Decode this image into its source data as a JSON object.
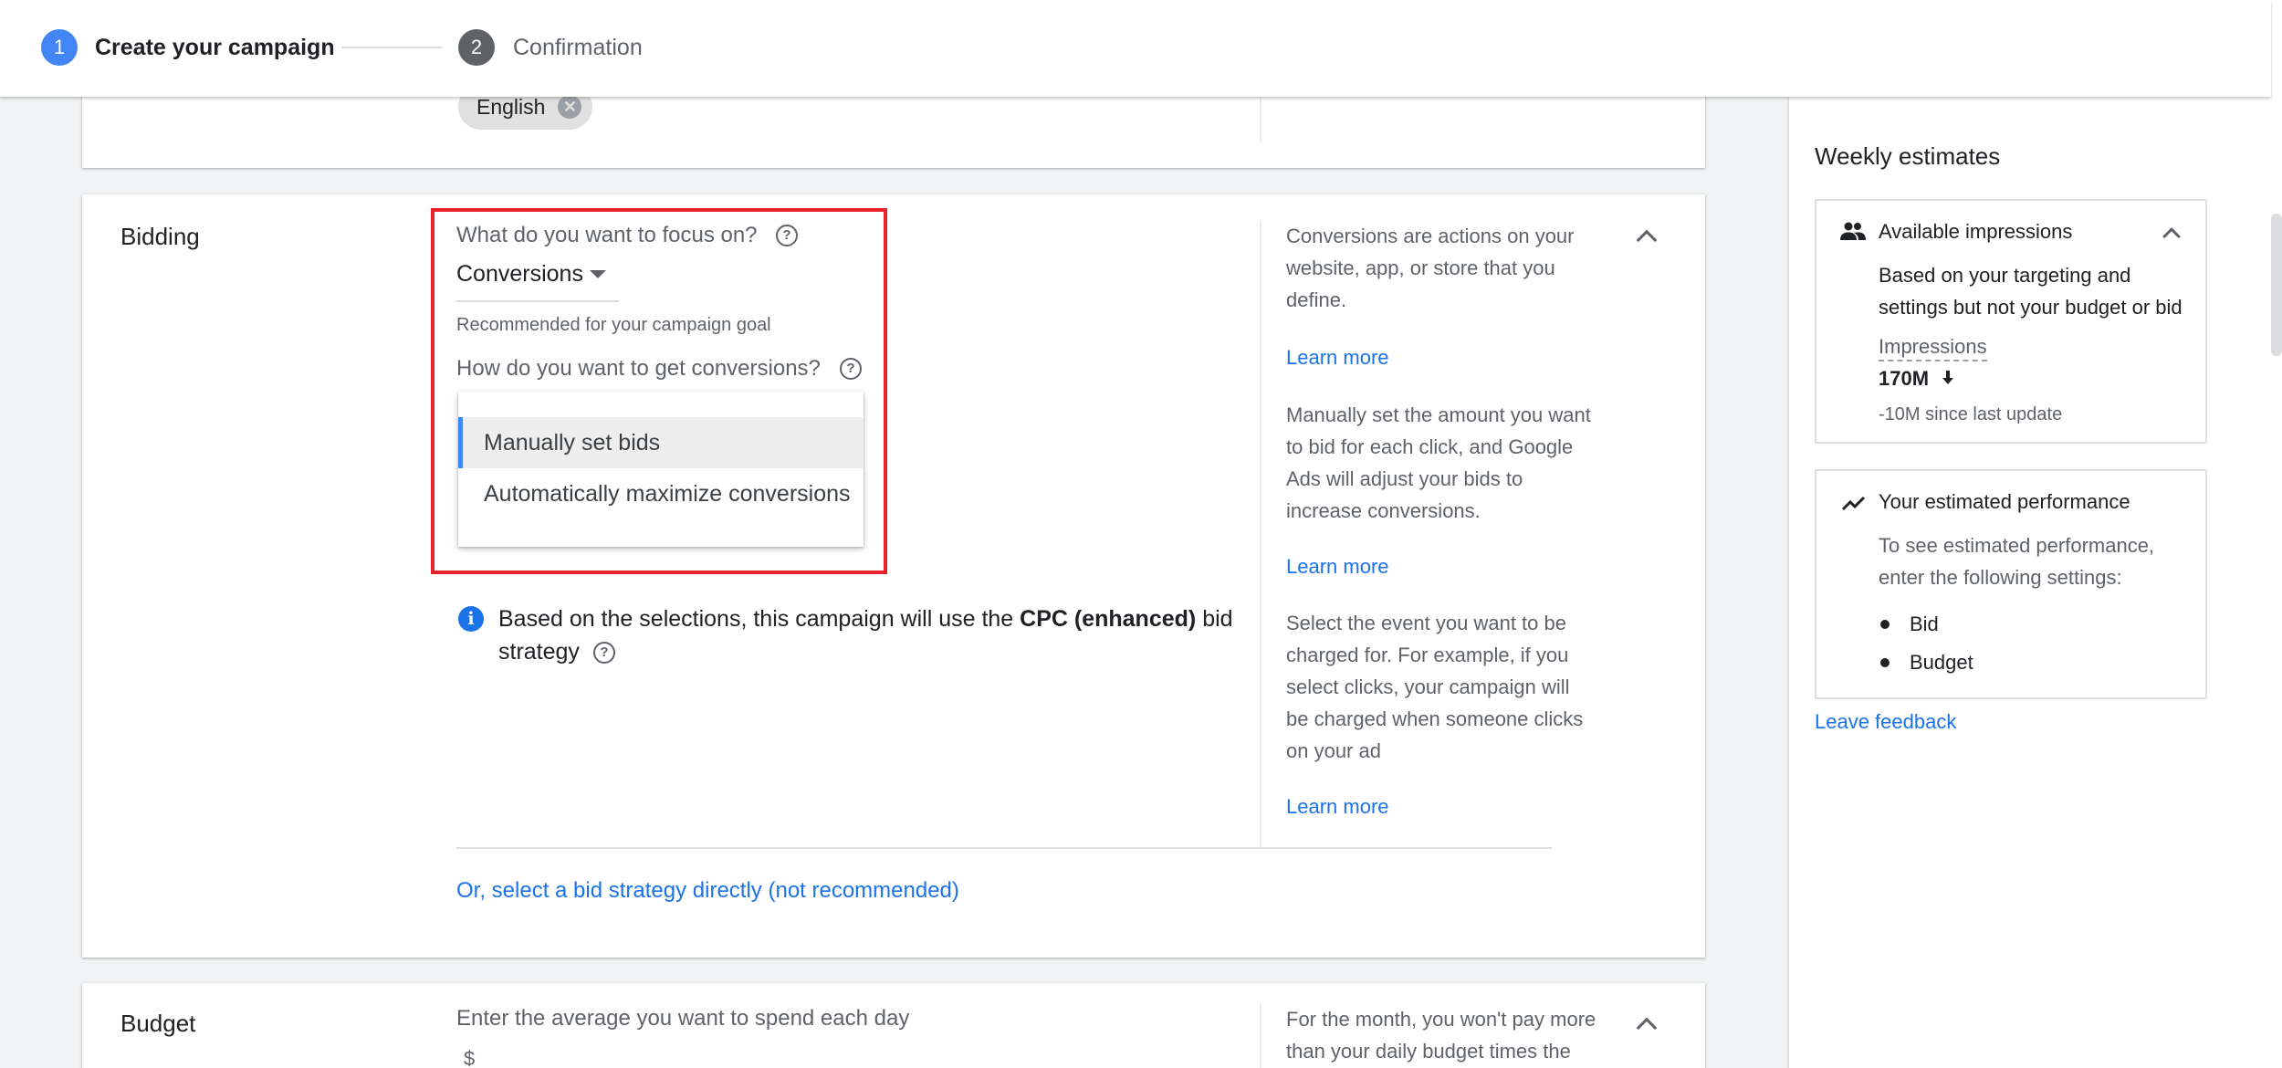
{
  "stepper": {
    "step1": {
      "number": "1",
      "label": "Create your campaign"
    },
    "step2": {
      "number": "2",
      "label": "Confirmation"
    }
  },
  "languages": {
    "chip_label": "English"
  },
  "bidding": {
    "title": "Bidding",
    "focus_question": "What do you want to focus on?",
    "focus_value": "Conversions",
    "focus_note": "Recommended for your campaign goal",
    "method_question": "How do you want to get conversions?",
    "method_options": [
      "Manually set bids",
      "Automatically maximize conversions"
    ],
    "selected_option_index": 0,
    "info_prefix": "Based on the selections, this campaign will use the ",
    "info_strategy": "CPC (enhanced)",
    "info_suffix": " bid",
    "info_line2": "strategy",
    "direct_link": "Or, select a bid strategy directly (not recommended)",
    "help": {
      "para1_lines": [
        "Conversions are actions on your",
        "website, app, or store that you",
        "define."
      ],
      "learn_more_1": "Learn more",
      "para2_lines": [
        "Manually set the amount you want",
        "to bid for each click, and Google",
        "Ads will adjust your bids to",
        "increase conversions."
      ],
      "learn_more_2": "Learn more",
      "para3_lines": [
        "Select the event you want to be",
        "charged for. For example, if you",
        "select clicks, your campaign will",
        "be charged when someone clicks",
        "on your ad"
      ],
      "learn_more_3": "Learn more"
    }
  },
  "budget": {
    "title": "Budget",
    "question": "Enter the average you want to spend each day",
    "currency": "$",
    "help_lines": [
      "For the month, you won't pay more",
      "than your daily budget times the"
    ]
  },
  "estimates": {
    "heading": "Weekly estimates",
    "impressions_card": {
      "title": "Available impressions",
      "desc_lines": [
        "Based on your targeting and",
        "settings but not your budget or bid"
      ],
      "metric_label": "Impressions",
      "metric_value": "170M",
      "change_text": "-10M since last update"
    },
    "performance_card": {
      "title": "Your estimated performance",
      "desc_lines": [
        "To see estimated performance,",
        "enter the following settings:"
      ],
      "items": [
        "Bid",
        "Budget"
      ]
    },
    "feedback_link": "Leave feedback"
  },
  "colors": {
    "accent_blue": "#1a73e8",
    "step_active": "#4285f4",
    "highlight_red": "#e8212a"
  }
}
